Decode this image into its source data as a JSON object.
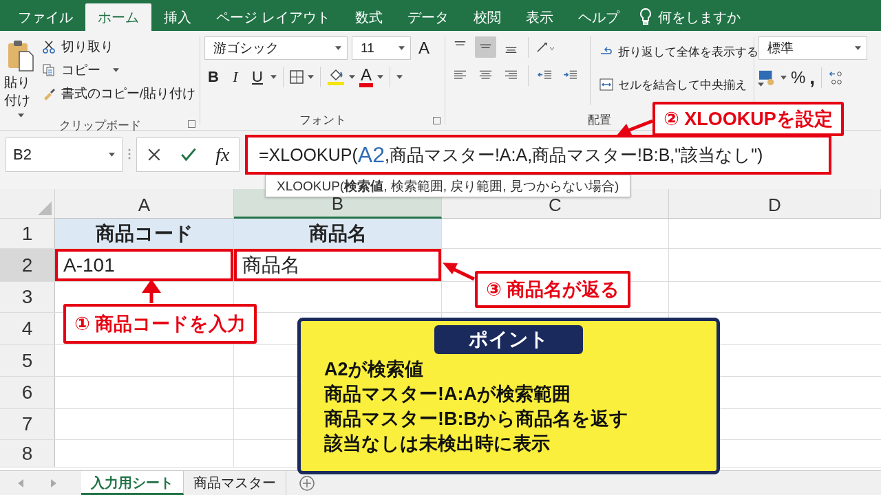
{
  "menu_tabs": [
    {
      "label": "ファイル",
      "selected": false
    },
    {
      "label": "ホーム",
      "selected": true
    },
    {
      "label": "挿入",
      "selected": false
    },
    {
      "label": "ページ レイアウト",
      "selected": false
    },
    {
      "label": "数式",
      "selected": false
    },
    {
      "label": "データ",
      "selected": false
    },
    {
      "label": "校閲",
      "selected": false
    },
    {
      "label": "表示",
      "selected": false
    },
    {
      "label": "ヘルプ",
      "selected": false
    }
  ],
  "tell_me": "何をしますか",
  "ribbon": {
    "clipboard": {
      "paste": "貼り付け",
      "cut": "切り取り",
      "copy": "コピー",
      "format_painter": "書式のコピー/貼り付け",
      "label": "クリップボード"
    },
    "font": {
      "name": "游ゴシック",
      "size": "11",
      "grow": "A",
      "bold": "B",
      "italic": "I",
      "underline": "U",
      "font_color": "A",
      "label": "フォント"
    },
    "alignment": {
      "vertical": [
        {
          "selected": false
        },
        {
          "selected": true
        },
        {
          "selected": false
        }
      ],
      "wrap": "折り返して全体を表示する",
      "merge": "セルを結合して中央揃え",
      "label": "配置"
    },
    "number": {
      "format": "標準",
      "percent": "%",
      "comma": ","
    }
  },
  "formula_bar": {
    "name_box": "B2",
    "fx": "fx",
    "formula_before": "=XLOOKUP(",
    "formula_ref": "A2",
    "formula_after": ",商品マスター!A:A,商品マスター!B:B,\"該当なし\")",
    "tooltip": "XLOOKUP(**検索値**, 検索範囲, 戻り範囲, 見つからない場合)"
  },
  "grid": {
    "columns": [
      {
        "label": "A",
        "selected": false
      },
      {
        "label": "B",
        "selected": true
      },
      {
        "label": "C",
        "selected": false
      },
      {
        "label": "D",
        "selected": false
      }
    ],
    "rows": [
      {
        "label": "1",
        "selected": false,
        "kind": "header",
        "cells": [
          {
            "value": "商品コード",
            "highlight": false
          },
          {
            "value": "商品名",
            "highlight": false
          }
        ]
      },
      {
        "label": "2",
        "selected": true,
        "kind": "data",
        "cells": [
          {
            "value": "A-101",
            "highlight": true
          },
          {
            "value": "商品名",
            "highlight": true
          }
        ]
      },
      {
        "label": "3",
        "selected": false,
        "kind": "data"
      },
      {
        "label": "4",
        "selected": false,
        "kind": "data"
      },
      {
        "label": "5",
        "selected": false,
        "kind": "data"
      },
      {
        "label": "6",
        "selected": false,
        "kind": "data"
      },
      {
        "label": "7",
        "selected": false,
        "kind": "data"
      },
      {
        "label": "8",
        "selected": false,
        "kind": "data"
      }
    ]
  },
  "sheet_tabs": [
    {
      "label": "入力用シート",
      "selected": true
    },
    {
      "label": "商品マスター",
      "selected": false
    }
  ],
  "callouts": [
    "① 商品コードを入力",
    "② XLOOKUPを設定",
    "③ 商品名が返る"
  ],
  "point": {
    "title": "ポイント",
    "lines": [
      "A2が検索値",
      "商品マスター!A:Aが検索範囲",
      "商品マスター!B:Bから商品名を返す",
      "該当なしは未検出時に表示"
    ]
  }
}
